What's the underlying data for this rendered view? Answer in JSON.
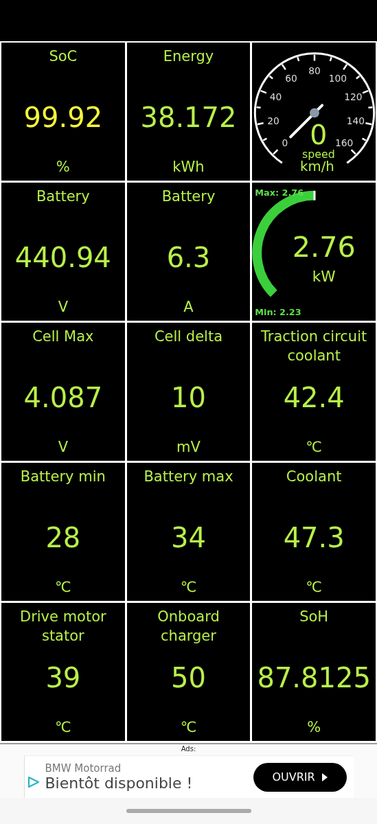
{
  "tiles": [
    {
      "kind": "value",
      "title": "SoC",
      "value": "99.92",
      "unit": "%",
      "color": "#f5f53a"
    },
    {
      "kind": "value",
      "title": "Energy",
      "value": "38.172",
      "unit": "kWh",
      "color": "#b8f04a"
    },
    {
      "kind": "speedometer",
      "ticks": [
        "0",
        "20",
        "40",
        "60",
        "80",
        "100",
        "120",
        "140",
        "160"
      ],
      "value": "0",
      "label": "speed",
      "unit": "km/h"
    },
    {
      "kind": "value",
      "title": "Battery",
      "value": "440.94",
      "unit": "V",
      "color": "#b8f04a"
    },
    {
      "kind": "value",
      "title": "Battery",
      "value": "6.3",
      "unit": "A",
      "color": "#b8f04a"
    },
    {
      "kind": "power_gauge",
      "max": "Max: 2.76",
      "min": "Min: 2.23",
      "value": "2.76",
      "unit": "kW"
    },
    {
      "kind": "value",
      "title": "Cell Max",
      "value": "4.087",
      "unit": "V",
      "color": "#b8f04a"
    },
    {
      "kind": "value",
      "title": "Cell delta",
      "value": "10",
      "unit": "mV",
      "color": "#b8f04a"
    },
    {
      "kind": "value",
      "title": "Traction circuit coolant",
      "value": "42.4",
      "unit": "℃",
      "color": "#b8f04a"
    },
    {
      "kind": "value",
      "title": "Battery min",
      "value": "28",
      "unit": "℃",
      "color": "#b8f04a"
    },
    {
      "kind": "value",
      "title": "Battery max",
      "value": "34",
      "unit": "℃",
      "color": "#b8f04a"
    },
    {
      "kind": "value",
      "title": "Coolant",
      "value": "47.3",
      "unit": "℃",
      "color": "#b8f04a"
    },
    {
      "kind": "value",
      "title": "Drive motor stator",
      "value": "39",
      "unit": "℃",
      "color": "#b8f04a"
    },
    {
      "kind": "value",
      "title": "Onboard charger",
      "value": "50",
      "unit": "℃",
      "color": "#b8f04a"
    },
    {
      "kind": "value",
      "title": "SoH",
      "value": "87.8125",
      "unit": "%",
      "color": "#b8f04a"
    }
  ],
  "ads": {
    "label": "Ads:",
    "advertiser": "BMW Motorrad",
    "headline": "Bientôt disponible !",
    "button": "OUVRIR"
  }
}
